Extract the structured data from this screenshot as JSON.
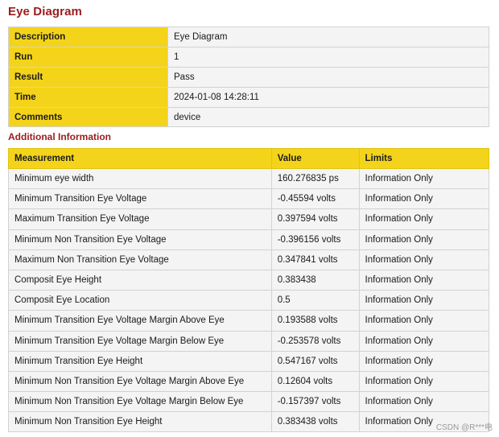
{
  "title": "Eye Diagram",
  "summary": [
    {
      "key": "Description",
      "value": "Eye Diagram"
    },
    {
      "key": "Run",
      "value": "1"
    },
    {
      "key": "Result",
      "value": "Pass"
    },
    {
      "key": "Time",
      "value": "2024-01-08 14:28:11"
    },
    {
      "key": "Comments",
      "value": "device"
    }
  ],
  "additional_title": "Additional Information",
  "measure_headers": {
    "measurement": "Measurement",
    "value": "Value",
    "limits": "Limits"
  },
  "measurements": [
    {
      "name": "Minimum eye width",
      "value": "160.276835 ps",
      "limits": "Information Only"
    },
    {
      "name": "Minimum Transition Eye Voltage",
      "value": "-0.45594 volts",
      "limits": "Information Only"
    },
    {
      "name": "Maximum Transition Eye Voltage",
      "value": "0.397594 volts",
      "limits": "Information Only"
    },
    {
      "name": "Minimum Non Transition Eye Voltage",
      "value": "-0.396156 volts",
      "limits": "Information Only"
    },
    {
      "name": "Maximum Non Transition Eye Voltage",
      "value": "0.347841 volts",
      "limits": "Information Only"
    },
    {
      "name": "Composit Eye Height",
      "value": "0.383438",
      "limits": "Information Only"
    },
    {
      "name": "Composit Eye Location",
      "value": "0.5",
      "limits": "Information Only"
    },
    {
      "name": "Minimum Transition Eye Voltage Margin Above Eye",
      "value": "0.193588 volts",
      "limits": "Information Only"
    },
    {
      "name": "Minimum Transition Eye Voltage Margin Below Eye",
      "value": "-0.253578 volts",
      "limits": "Information Only"
    },
    {
      "name": "Minimum Transition Eye Height",
      "value": "0.547167 volts",
      "limits": "Information Only"
    },
    {
      "name": "Minimum Non Transition Eye Voltage Margin Above Eye",
      "value": "0.12604 volts",
      "limits": "Information Only"
    },
    {
      "name": "Minimum Non Transition Eye Voltage Margin Below Eye",
      "value": "-0.157397 volts",
      "limits": "Information Only"
    },
    {
      "name": "Minimum Non Transition Eye Height",
      "value": "0.383438 volts",
      "limits": "Information Only"
    }
  ],
  "watermark": "CSDN @R***电"
}
